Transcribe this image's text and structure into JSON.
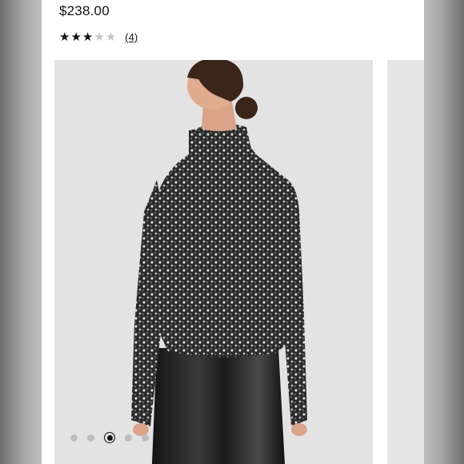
{
  "product": {
    "price": "$238.00",
    "rating": {
      "value": 3,
      "max": 5,
      "review_count": "(4)"
    }
  },
  "gallery": {
    "image": "product-photo-model-back-view-knit-turtleneck-sweater",
    "slide_count": 5,
    "active_index": 2
  },
  "colors": {
    "card": "#ffffff",
    "photo_background": "#e3e3e3",
    "star_filled": "#111111",
    "star_empty": "#c4c4c4"
  }
}
